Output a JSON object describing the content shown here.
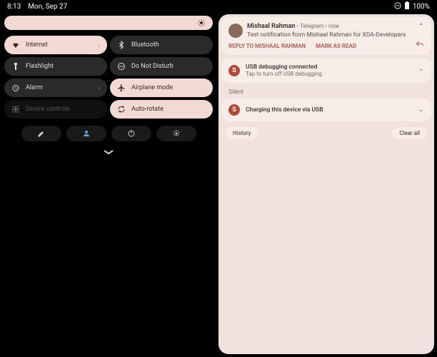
{
  "status": {
    "time": "8:13",
    "date": "Mon, Sep 27",
    "battery": "100%",
    "battery_icon": "battery-full",
    "dnd_icon": "dnd"
  },
  "brightness": {
    "icon": "brightness"
  },
  "qs": {
    "tiles": [
      {
        "label": "Internet",
        "icon": "wifi",
        "state": "active",
        "chev": "›"
      },
      {
        "label": "Bluetooth",
        "icon": "bluetooth",
        "state": "inactive",
        "chev": ""
      },
      {
        "label": "Flashlight",
        "icon": "flashlight",
        "state": "inactive",
        "chev": ""
      },
      {
        "label": "Do Not Disturb",
        "icon": "dnd",
        "state": "inactive",
        "chev": ""
      },
      {
        "label": "Alarm",
        "icon": "alarm",
        "state": "inactive",
        "chev": "›"
      },
      {
        "label": "Airplane mode",
        "icon": "airplane",
        "state": "active",
        "chev": ""
      },
      {
        "label": "Device controls",
        "icon": "home",
        "state": "disabled",
        "chev": ""
      },
      {
        "label": "Auto-rotate",
        "icon": "rotate",
        "state": "active",
        "chev": ""
      }
    ]
  },
  "bottom": {
    "edit": "edit",
    "user": "user",
    "power": "power",
    "settings": "settings"
  },
  "notifications": {
    "main": {
      "sender": "Mishaal Rahman",
      "app": "Telegram",
      "time": "now",
      "body": "Test notification from Mishaal Rahman for XDA-Developers",
      "action_reply": "REPLY TO MISHAAL RAHMAN",
      "action_read": "MARK AS READ"
    },
    "usb_debug": {
      "title": "USB debugging connected",
      "sub": "Tap to turn off USB debugging"
    },
    "silent_label": "Silent",
    "charging": {
      "title": "Charging this device via USB"
    },
    "footer": {
      "history": "History",
      "clear": "Clear all"
    }
  }
}
